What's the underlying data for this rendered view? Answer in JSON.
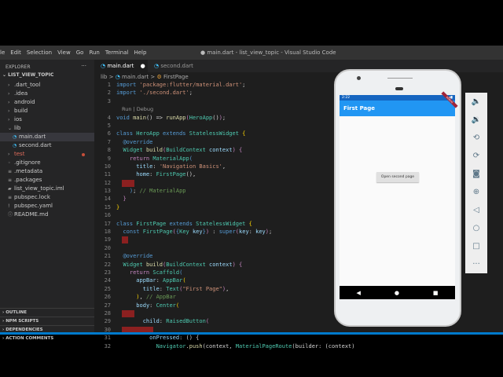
{
  "window_title": "● main.dart - list_view_topic - Visual Studio Code",
  "menu": [
    "le",
    "Edit",
    "Selection",
    "View",
    "Go",
    "Run",
    "Terminal",
    "Help"
  ],
  "explorer": {
    "header": "EXPLORER",
    "more": "···",
    "project": "LIST_VIEW_TOPIC",
    "items": [
      {
        "label": ".dart_tool",
        "icon": ">",
        "indent": 0
      },
      {
        "label": ".idea",
        "icon": ">",
        "indent": 0
      },
      {
        "label": "android",
        "icon": ">",
        "indent": 0
      },
      {
        "label": "build",
        "icon": ">",
        "indent": 0
      },
      {
        "label": "ios",
        "icon": ">",
        "indent": 0
      },
      {
        "label": "lib",
        "icon": "v",
        "indent": 0
      },
      {
        "label": "main.dart",
        "icon": "dart",
        "indent": 1,
        "selected": true
      },
      {
        "label": "second.dart",
        "icon": "dart",
        "indent": 1
      },
      {
        "label": "test",
        "icon": ">",
        "indent": 0,
        "modified": true
      },
      {
        "label": ".gitignore",
        "icon": "◦",
        "indent": 0
      },
      {
        "label": ".metadata",
        "icon": "≡",
        "indent": 0
      },
      {
        "label": ".packages",
        "icon": "≡",
        "indent": 0
      },
      {
        "label": "list_view_topic.iml",
        "icon": "▰",
        "indent": 0
      },
      {
        "label": "pubspec.lock",
        "icon": "≡",
        "indent": 0
      },
      {
        "label": "pubspec.yaml",
        "icon": "!",
        "indent": 0
      },
      {
        "label": "README.md",
        "icon": "ⓘ",
        "indent": 0
      }
    ],
    "panels": [
      "OUTLINE",
      "NPM SCRIPTS",
      "DEPENDENCIES",
      "ACTION COMMENTS"
    ]
  },
  "tabs": [
    {
      "label": "main.dart",
      "dirty": "●"
    },
    {
      "label": "second.dart"
    }
  ],
  "breadcrumb": [
    "lib",
    ">",
    "main.dart",
    ">",
    "FirstPage"
  ],
  "code": [
    {
      "n": "1",
      "seg": [
        [
          "k",
          "import "
        ],
        [
          "s",
          "'package:flutter/material.dart'"
        ],
        [
          "w",
          ";"
        ]
      ]
    },
    {
      "n": "2",
      "seg": [
        [
          "k",
          "import "
        ],
        [
          "s",
          "'./second.dart'"
        ],
        [
          "w",
          ";"
        ]
      ]
    },
    {
      "n": "3",
      "seg": []
    },
    {
      "lens": "Run | Debug"
    },
    {
      "n": "4",
      "seg": [
        [
          "k",
          "void "
        ],
        [
          "f",
          "main"
        ],
        [
          "w",
          "() => "
        ],
        [
          "f",
          "runApp"
        ],
        [
          "m",
          "("
        ],
        [
          "t",
          "HeroApp"
        ],
        [
          "w",
          "()"
        ],
        [
          "m",
          ")"
        ],
        [
          "w",
          ";"
        ]
      ]
    },
    {
      "n": "5",
      "seg": []
    },
    {
      "n": "6",
      "seg": [
        [
          "k",
          "class "
        ],
        [
          "t",
          "HeroApp "
        ],
        [
          "k",
          "extends "
        ],
        [
          "t",
          "StatelessWidget "
        ],
        [
          "y",
          "{"
        ]
      ]
    },
    {
      "n": "7",
      "seg": [
        [
          "w",
          "  "
        ],
        [
          "k",
          "@override"
        ]
      ]
    },
    {
      "n": "8",
      "seg": [
        [
          "w",
          "  "
        ],
        [
          "t",
          "Widget "
        ],
        [
          "f",
          "build"
        ],
        [
          "m",
          "("
        ],
        [
          "t",
          "BuildContext "
        ],
        [
          "p",
          "context"
        ],
        [
          "m",
          ") "
        ],
        [
          "m",
          "{"
        ]
      ]
    },
    {
      "n": "9",
      "seg": [
        [
          "w",
          "    "
        ],
        [
          "m",
          "return "
        ],
        [
          "t",
          "MaterialApp"
        ],
        [
          "k",
          "("
        ]
      ]
    },
    {
      "n": "10",
      "seg": [
        [
          "w",
          "      "
        ],
        [
          "p",
          "title"
        ],
        [
          "w",
          ": "
        ],
        [
          "s",
          "'Navigation Basics'"
        ],
        [
          "w",
          ","
        ]
      ]
    },
    {
      "n": "11",
      "seg": [
        [
          "w",
          "      "
        ],
        [
          "p",
          "home"
        ],
        [
          "w",
          ": "
        ],
        [
          "t",
          "FirstPage"
        ],
        [
          "w",
          "(),"
        ]
      ]
    },
    {
      "n": "12",
      "seg": [],
      "err": 2
    },
    {
      "n": "13",
      "seg": [
        [
          "w",
          "    "
        ],
        [
          "k",
          ")"
        ],
        [
          "w",
          "; "
        ],
        [
          "c",
          "// MaterialApp"
        ]
      ]
    },
    {
      "n": "14",
      "seg": [
        [
          "w",
          "  "
        ],
        [
          "m",
          "}"
        ]
      ]
    },
    {
      "n": "15",
      "seg": [
        [
          "y",
          "}"
        ]
      ]
    },
    {
      "n": "16",
      "seg": []
    },
    {
      "n": "17",
      "seg": [
        [
          "k",
          "class "
        ],
        [
          "t",
          "FirstPage "
        ],
        [
          "k",
          "extends "
        ],
        [
          "t",
          "StatelessWidget "
        ],
        [
          "y",
          "{"
        ]
      ]
    },
    {
      "n": "18",
      "seg": [
        [
          "w",
          "  "
        ],
        [
          "k",
          "const "
        ],
        [
          "t",
          "FirstPage"
        ],
        [
          "m",
          "("
        ],
        [
          "k",
          "{"
        ],
        [
          "t",
          "Key "
        ],
        [
          "p",
          "key"
        ],
        [
          "k",
          "}"
        ],
        [
          "m",
          ")"
        ],
        [
          "w",
          " : "
        ],
        [
          "k",
          "super"
        ],
        [
          "m",
          "("
        ],
        [
          "p",
          "key"
        ],
        [
          "w",
          ": "
        ],
        [
          "p",
          "key"
        ],
        [
          "m",
          ")"
        ],
        [
          "w",
          ";"
        ]
      ]
    },
    {
      "n": "19",
      "seg": [],
      "err": 1
    },
    {
      "n": "20",
      "seg": []
    },
    {
      "n": "21",
      "seg": [
        [
          "w",
          "  "
        ],
        [
          "k",
          "@override"
        ]
      ]
    },
    {
      "n": "22",
      "seg": [
        [
          "w",
          "  "
        ],
        [
          "t",
          "Widget "
        ],
        [
          "f",
          "build"
        ],
        [
          "m",
          "("
        ],
        [
          "t",
          "BuildContext "
        ],
        [
          "p",
          "context"
        ],
        [
          "m",
          ") {"
        ]
      ]
    },
    {
      "n": "23",
      "seg": [
        [
          "w",
          "    "
        ],
        [
          "m",
          "return "
        ],
        [
          "t",
          "Scaffold"
        ],
        [
          "k",
          "("
        ]
      ]
    },
    {
      "n": "24",
      "seg": [
        [
          "w",
          "      "
        ],
        [
          "p",
          "appBar"
        ],
        [
          "w",
          ": "
        ],
        [
          "t",
          "AppBar"
        ],
        [
          "y",
          "("
        ]
      ]
    },
    {
      "n": "25",
      "seg": [
        [
          "w",
          "        "
        ],
        [
          "p",
          "title"
        ],
        [
          "w",
          ": "
        ],
        [
          "t",
          "Text"
        ],
        [
          "m",
          "("
        ],
        [
          "s",
          "\"First Page\""
        ],
        [
          "m",
          ")"
        ],
        [
          "w",
          ","
        ]
      ]
    },
    {
      "n": "26",
      "seg": [
        [
          "w",
          "      "
        ],
        [
          "y",
          ")"
        ],
        [
          "w",
          ", "
        ],
        [
          "c",
          "// AppBar"
        ]
      ]
    },
    {
      "n": "27",
      "seg": [
        [
          "w",
          "      "
        ],
        [
          "p",
          "body"
        ],
        [
          "w",
          ": "
        ],
        [
          "t",
          "Center"
        ],
        [
          "y",
          "("
        ]
      ]
    },
    {
      "n": "28",
      "seg": [],
      "err": 2
    },
    {
      "n": "29",
      "seg": [
        [
          "w",
          "        "
        ],
        [
          "p",
          "child"
        ],
        [
          "w",
          ": "
        ],
        [
          "t",
          "RaisedButton"
        ],
        [
          "m",
          "("
        ]
      ]
    },
    {
      "n": "30",
      "seg": [],
      "err": 5
    },
    {
      "n": "31",
      "seg": [
        [
          "w",
          "          "
        ],
        [
          "p",
          "onPressed"
        ],
        [
          "w",
          ": () {"
        ]
      ]
    },
    {
      "n": "32",
      "seg": [
        [
          "w",
          "            "
        ],
        [
          "t",
          "Navigator"
        ],
        [
          "w",
          "."
        ],
        [
          "f",
          "push"
        ],
        [
          "w",
          "(context, "
        ],
        [
          "t",
          "MaterialPageRoute"
        ],
        [
          "w",
          "(builder: (context)"
        ]
      ]
    }
  ],
  "emulator": {
    "time": "2:22",
    "app_bar_title": "First Page",
    "debug_banner": "DEBUG",
    "button_label": "Open second page",
    "nav": [
      "◀",
      "●",
      "■"
    ],
    "tools": [
      "volume-up",
      "volume-down",
      "rotate-left",
      "rotate-right",
      "camera",
      "zoom",
      "back",
      "home",
      "overview",
      "more"
    ],
    "tool_glyphs": [
      "🔈",
      "🔉",
      "⟲",
      "⟳",
      "◙",
      "⊕",
      "◁",
      "○",
      "□",
      "···"
    ]
  },
  "colors": {
    "appbar": "#2196f3",
    "statusbar": "#1565c0",
    "accent": "#007acc"
  }
}
